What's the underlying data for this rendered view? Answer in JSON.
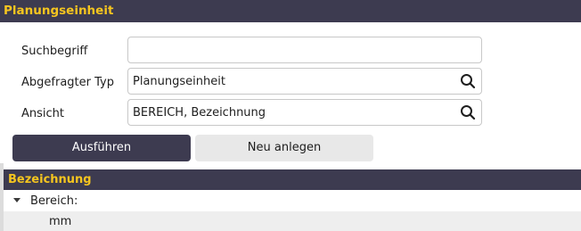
{
  "window": {
    "title": "Planungseinheit"
  },
  "form": {
    "search": {
      "label": "Suchbegriff",
      "value": ""
    },
    "type": {
      "label": "Abgefragter Typ",
      "value": "Planungseinheit",
      "icon": "search-icon"
    },
    "view": {
      "label": "Ansicht",
      "value": "BEREICH, Bezeichnung",
      "icon": "search-icon"
    }
  },
  "buttons": {
    "execute": "Ausführen",
    "create": "Neu anlegen"
  },
  "list": {
    "column_header": "Bezeichnung",
    "group": {
      "label": "Bereich:",
      "expanded": true
    },
    "items": [
      {
        "label": "mm"
      }
    ]
  },
  "colors": {
    "header_bg": "#3d3b50",
    "header_text": "#f5c51f"
  }
}
